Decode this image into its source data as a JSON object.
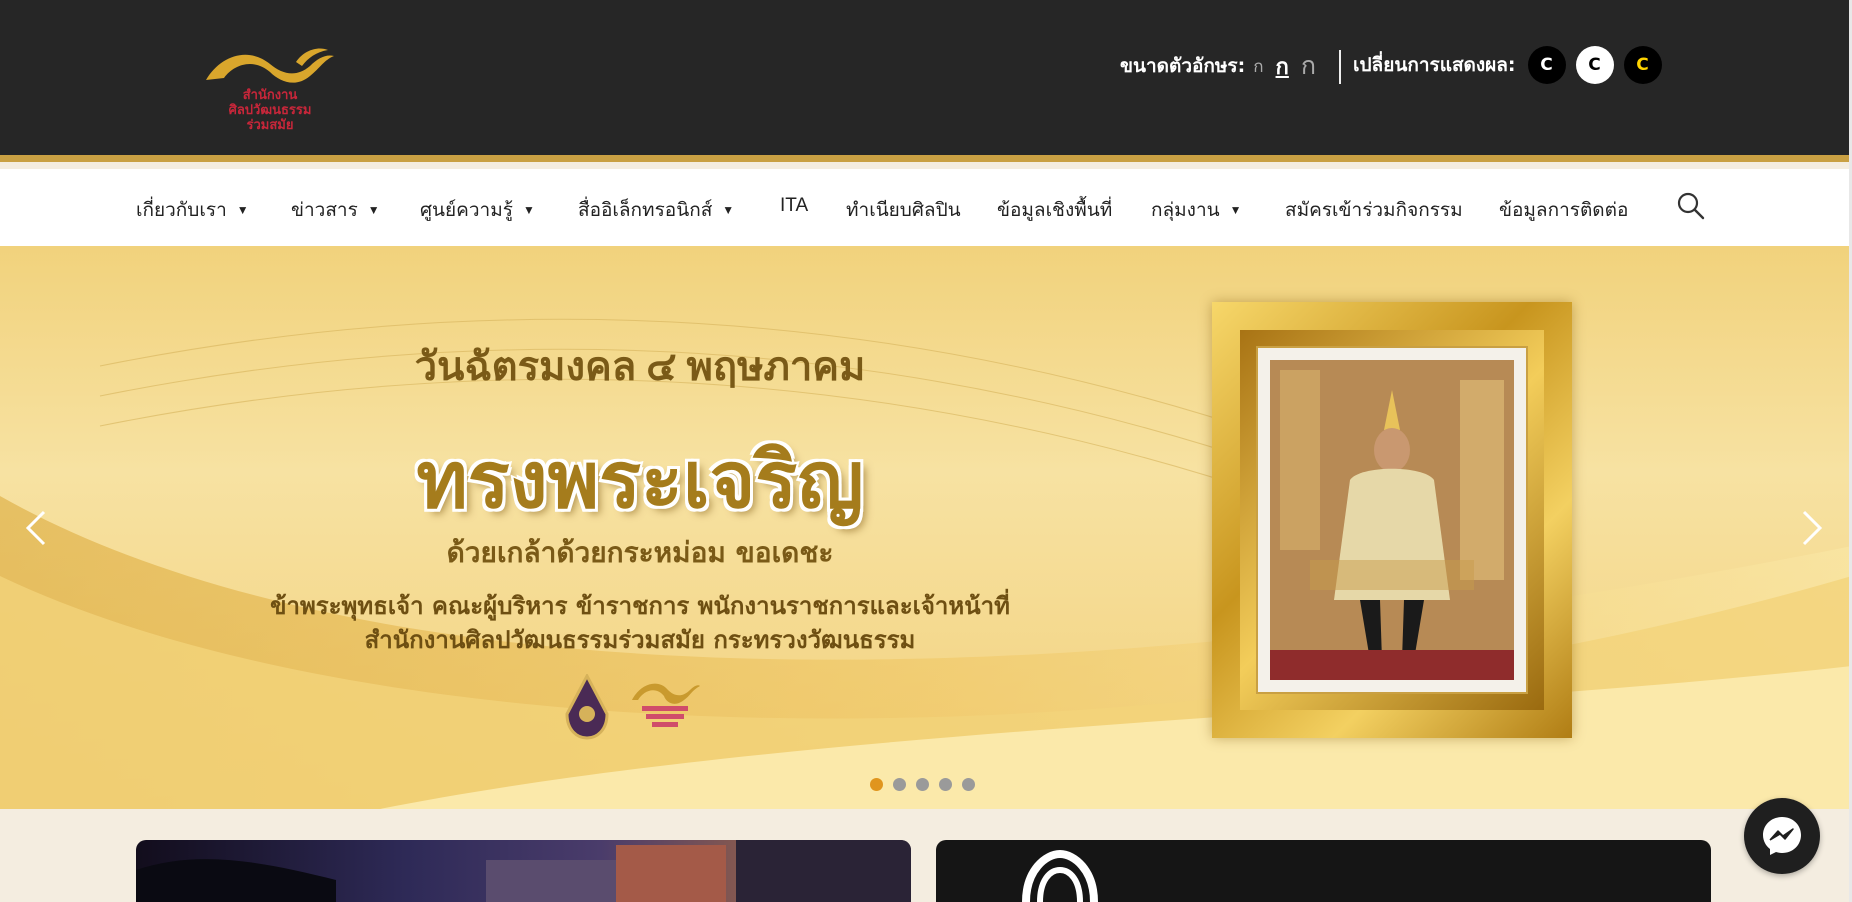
{
  "header": {
    "logo": {
      "line1": "สำนักงาน",
      "line2": "ศิลปวัฒนธรรม",
      "line3": "ร่วมสมัย"
    },
    "font_size": {
      "label": "ขนาดตัวอักษร:",
      "small": "ก",
      "medium": "ก",
      "large": "ก"
    },
    "display_mode": {
      "label": "เปลี่ยนการแสดงผล:",
      "opt1": "C",
      "opt2": "C",
      "opt3": "C"
    }
  },
  "nav": {
    "items": [
      {
        "label": "เกี่ยวกับเรา",
        "dropdown": true
      },
      {
        "label": "ข่าวสาร",
        "dropdown": true
      },
      {
        "label": "ศูนย์ความรู้",
        "dropdown": true
      },
      {
        "label": "สื่ออิเล็กทรอนิกส์",
        "dropdown": true
      },
      {
        "label": "ITA",
        "dropdown": false
      },
      {
        "label": "ทำเนียบศิลปิน",
        "dropdown": false
      },
      {
        "label": "ข้อมูลเชิงพื้นที่",
        "dropdown": false
      },
      {
        "label": "กลุ่มงาน",
        "dropdown": true
      },
      {
        "label": "สมัครเข้าร่วมกิจกรรม",
        "dropdown": false
      },
      {
        "label": "ข้อมูลการติดต่อ",
        "dropdown": false
      }
    ],
    "caret": "▼"
  },
  "hero": {
    "line1": "วันฉัตรมงคล ๔ พฤษภาคม",
    "line2": "ทรงพระเจริญ",
    "line3": "ด้วยเกล้าด้วยกระหม่อม ขอเดชะ",
    "line4": "ข้าพระพุทธเจ้า คณะผู้บริหาร ข้าราชการ พนักงานราชการและเจ้าหน้าที่",
    "line5": "สำนักงานศิลปวัฒนธรรมร่วมสมัย กระทรวงวัฒนธรรม",
    "slide_count": 5,
    "active_slide": 1
  },
  "colors": {
    "header_bg": "#262626",
    "accent_gold": "#c9a043",
    "active_dot": "#e0951e"
  }
}
